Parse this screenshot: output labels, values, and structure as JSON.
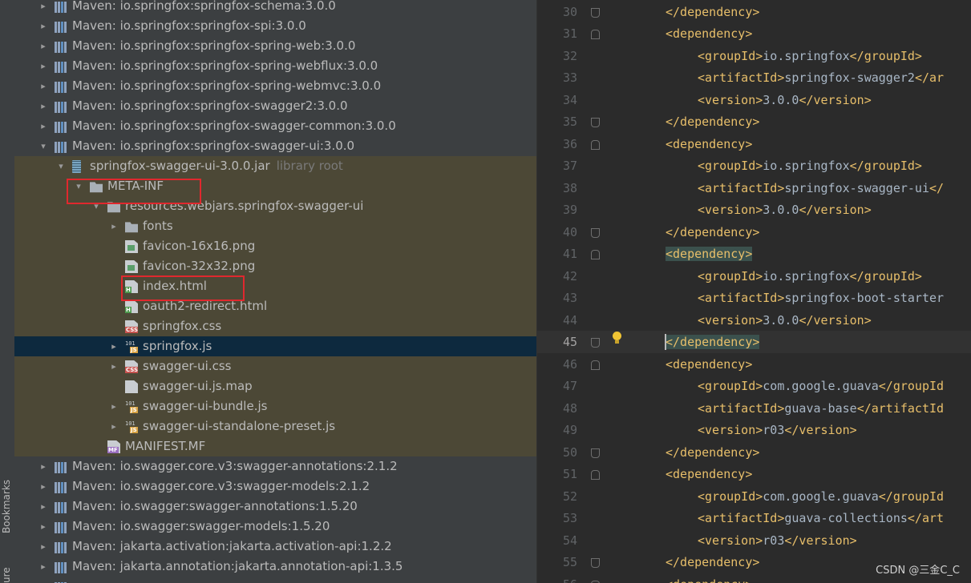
{
  "sidebar_stripe": {
    "bookmarks_label": "Bookmarks",
    "structure_label": "ure"
  },
  "project_tree": {
    "rows": [
      {
        "indent": 0,
        "arrow": "▸",
        "icon": "library-icon",
        "label": "Maven: io.springfox:springfox-schema:3.0.0"
      },
      {
        "indent": 0,
        "arrow": "▸",
        "icon": "library-icon",
        "label": "Maven: io.springfox:springfox-spi:3.0.0"
      },
      {
        "indent": 0,
        "arrow": "▸",
        "icon": "library-icon",
        "label": "Maven: io.springfox:springfox-spring-web:3.0.0"
      },
      {
        "indent": 0,
        "arrow": "▸",
        "icon": "library-icon",
        "label": "Maven: io.springfox:springfox-spring-webflux:3.0.0"
      },
      {
        "indent": 0,
        "arrow": "▸",
        "icon": "library-icon",
        "label": "Maven: io.springfox:springfox-spring-webmvc:3.0.0"
      },
      {
        "indent": 0,
        "arrow": "▸",
        "icon": "library-icon",
        "label": "Maven: io.springfox:springfox-swagger2:3.0.0"
      },
      {
        "indent": 0,
        "arrow": "▸",
        "icon": "library-icon",
        "label": "Maven: io.springfox:springfox-swagger-common:3.0.0"
      },
      {
        "indent": 0,
        "arrow": "▾",
        "icon": "library-icon",
        "label": "Maven: io.springfox:springfox-swagger-ui:3.0.0"
      },
      {
        "indent": 1,
        "arrow": "▾",
        "icon": "jar-icon",
        "label": "springfox-swagger-ui-3.0.0.jar",
        "hint": "library root",
        "lib": true
      },
      {
        "indent": 2,
        "arrow": "▾",
        "icon": "folder-icon",
        "label": "META-INF",
        "lib": true
      },
      {
        "indent": 3,
        "arrow": "▾",
        "icon": "folder-icon",
        "label": "resources.webjars.springfox-swagger-ui",
        "lib": true
      },
      {
        "indent": 4,
        "arrow": "▸",
        "icon": "folder-icon",
        "label": "fonts",
        "lib": true
      },
      {
        "indent": 4,
        "arrow": "",
        "icon": "png-file-icon",
        "label": "favicon-16x16.png",
        "lib": true
      },
      {
        "indent": 4,
        "arrow": "",
        "icon": "png-file-icon",
        "label": "favicon-32x32.png",
        "lib": true
      },
      {
        "indent": 4,
        "arrow": "",
        "icon": "html-file-icon",
        "label": "index.html",
        "lib": true
      },
      {
        "indent": 4,
        "arrow": "",
        "icon": "html-file-icon",
        "label": "oauth2-redirect.html",
        "lib": true
      },
      {
        "indent": 4,
        "arrow": "",
        "icon": "css-file-icon",
        "label": "springfox.css",
        "lib": true
      },
      {
        "indent": 4,
        "arrow": "▸",
        "icon": "js-file-icon",
        "label": "springfox.js",
        "selected": true
      },
      {
        "indent": 4,
        "arrow": "▸",
        "icon": "css-file-icon",
        "label": "swagger-ui.css",
        "lib": true
      },
      {
        "indent": 4,
        "arrow": "",
        "icon": "map-file-icon",
        "label": "swagger-ui.js.map",
        "lib": true
      },
      {
        "indent": 4,
        "arrow": "▸",
        "icon": "js-file-icon",
        "label": "swagger-ui-bundle.js",
        "lib": true
      },
      {
        "indent": 4,
        "arrow": "▸",
        "icon": "js-file-icon",
        "label": "swagger-ui-standalone-preset.js",
        "lib": true
      },
      {
        "indent": 3,
        "arrow": "",
        "icon": "manifest-file-icon",
        "label": "MANIFEST.MF",
        "lib": true
      },
      {
        "indent": 0,
        "arrow": "▸",
        "icon": "library-icon",
        "label": "Maven: io.swagger.core.v3:swagger-annotations:2.1.2"
      },
      {
        "indent": 0,
        "arrow": "▸",
        "icon": "library-icon",
        "label": "Maven: io.swagger.core.v3:swagger-models:2.1.2"
      },
      {
        "indent": 0,
        "arrow": "▸",
        "icon": "library-icon",
        "label": "Maven: io.swagger:swagger-annotations:1.5.20"
      },
      {
        "indent": 0,
        "arrow": "▸",
        "icon": "library-icon",
        "label": "Maven: io.swagger:swagger-models:1.5.20"
      },
      {
        "indent": 0,
        "arrow": "▸",
        "icon": "library-icon",
        "label": "Maven: jakarta.activation:jakarta.activation-api:1.2.2"
      },
      {
        "indent": 0,
        "arrow": "▸",
        "icon": "library-icon",
        "label": "Maven: jakarta.annotation:jakarta.annotation-api:1.3.5"
      },
      {
        "indent": 0,
        "arrow": "▸",
        "icon": "library-icon",
        "label": ""
      }
    ]
  },
  "editor": {
    "current_line": 45,
    "lines": [
      {
        "num": "30",
        "indent": 1,
        "tokens": [
          [
            "tag",
            "</dependency>"
          ]
        ]
      },
      {
        "num": "31",
        "indent": 1,
        "tokens": [
          [
            "tag",
            "<dependency>"
          ]
        ]
      },
      {
        "num": "32",
        "indent": 2,
        "tokens": [
          [
            "tag",
            "<groupId>"
          ],
          [
            "text",
            "io.springfox"
          ],
          [
            "tag",
            "</groupId>"
          ]
        ]
      },
      {
        "num": "33",
        "indent": 2,
        "tokens": [
          [
            "tag",
            "<artifactId>"
          ],
          [
            "text",
            "springfox-swagger2"
          ],
          [
            "tag",
            "</ar"
          ]
        ]
      },
      {
        "num": "34",
        "indent": 2,
        "tokens": [
          [
            "tag",
            "<version>"
          ],
          [
            "text",
            "3.0.0"
          ],
          [
            "tag",
            "</version>"
          ]
        ]
      },
      {
        "num": "35",
        "indent": 1,
        "tokens": [
          [
            "tag",
            "</dependency>"
          ]
        ]
      },
      {
        "num": "36",
        "indent": 1,
        "tokens": [
          [
            "tag",
            "<dependency>"
          ]
        ]
      },
      {
        "num": "37",
        "indent": 2,
        "tokens": [
          [
            "tag",
            "<groupId>"
          ],
          [
            "text",
            "io.springfox"
          ],
          [
            "tag",
            "</groupId>"
          ]
        ]
      },
      {
        "num": "38",
        "indent": 2,
        "tokens": [
          [
            "tag",
            "<artifactId>"
          ],
          [
            "text",
            "springfox-swagger-ui"
          ],
          [
            "tag",
            "</"
          ]
        ]
      },
      {
        "num": "39",
        "indent": 2,
        "tokens": [
          [
            "tag",
            "<version>"
          ],
          [
            "text",
            "3.0.0"
          ],
          [
            "tag",
            "</version>"
          ]
        ]
      },
      {
        "num": "40",
        "indent": 1,
        "tokens": [
          [
            "tag",
            "</dependency>"
          ]
        ]
      },
      {
        "num": "41",
        "indent": 1,
        "tokens": [
          [
            "taghl",
            "<dependency>"
          ]
        ]
      },
      {
        "num": "42",
        "indent": 2,
        "tokens": [
          [
            "tag",
            "<groupId>"
          ],
          [
            "text",
            "io.springfox"
          ],
          [
            "tag",
            "</groupId>"
          ]
        ]
      },
      {
        "num": "43",
        "indent": 2,
        "tokens": [
          [
            "tag",
            "<artifactId>"
          ],
          [
            "text",
            "springfox-boot-starter"
          ]
        ]
      },
      {
        "num": "44",
        "indent": 2,
        "tokens": [
          [
            "tag",
            "<version>"
          ],
          [
            "text",
            "3.0.0"
          ],
          [
            "tag",
            "</version>"
          ]
        ]
      },
      {
        "num": "45",
        "indent": 1,
        "tokens": [
          [
            "taghl",
            "</dependency>"
          ]
        ]
      },
      {
        "num": "46",
        "indent": 1,
        "tokens": [
          [
            "tag",
            "<dependency>"
          ]
        ]
      },
      {
        "num": "47",
        "indent": 2,
        "tokens": [
          [
            "tag",
            "<groupId>"
          ],
          [
            "text",
            "com.google.guava"
          ],
          [
            "tag",
            "</groupId"
          ]
        ]
      },
      {
        "num": "48",
        "indent": 2,
        "tokens": [
          [
            "tag",
            "<artifactId>"
          ],
          [
            "text",
            "guava-base"
          ],
          [
            "tag",
            "</artifactId"
          ]
        ]
      },
      {
        "num": "49",
        "indent": 2,
        "tokens": [
          [
            "tag",
            "<version>"
          ],
          [
            "text",
            "r03"
          ],
          [
            "tag",
            "</version>"
          ]
        ]
      },
      {
        "num": "50",
        "indent": 1,
        "tokens": [
          [
            "tag",
            "</dependency>"
          ]
        ]
      },
      {
        "num": "51",
        "indent": 1,
        "tokens": [
          [
            "tag",
            "<dependency>"
          ]
        ]
      },
      {
        "num": "52",
        "indent": 2,
        "tokens": [
          [
            "tag",
            "<groupId>"
          ],
          [
            "text",
            "com.google.guava"
          ],
          [
            "tag",
            "</groupId"
          ]
        ]
      },
      {
        "num": "53",
        "indent": 2,
        "tokens": [
          [
            "tag",
            "<artifactId>"
          ],
          [
            "text",
            "guava-collections"
          ],
          [
            "tag",
            "</art"
          ]
        ]
      },
      {
        "num": "54",
        "indent": 2,
        "tokens": [
          [
            "tag",
            "<version>"
          ],
          [
            "text",
            "r03"
          ],
          [
            "tag",
            "</version>"
          ]
        ]
      },
      {
        "num": "55",
        "indent": 1,
        "tokens": [
          [
            "tag",
            "</dependency>"
          ]
        ]
      },
      {
        "num": "56",
        "indent": 1,
        "tokens": [
          [
            "tag",
            "<dependency>"
          ]
        ]
      }
    ]
  },
  "watermark": "CSDN @三金C_C",
  "colors": {
    "tag": "#e8bf6a",
    "text": "#a9b7c6",
    "highlight_box": "#e0282e",
    "selection": "#0d293e",
    "library_bg": "#4c4836"
  }
}
